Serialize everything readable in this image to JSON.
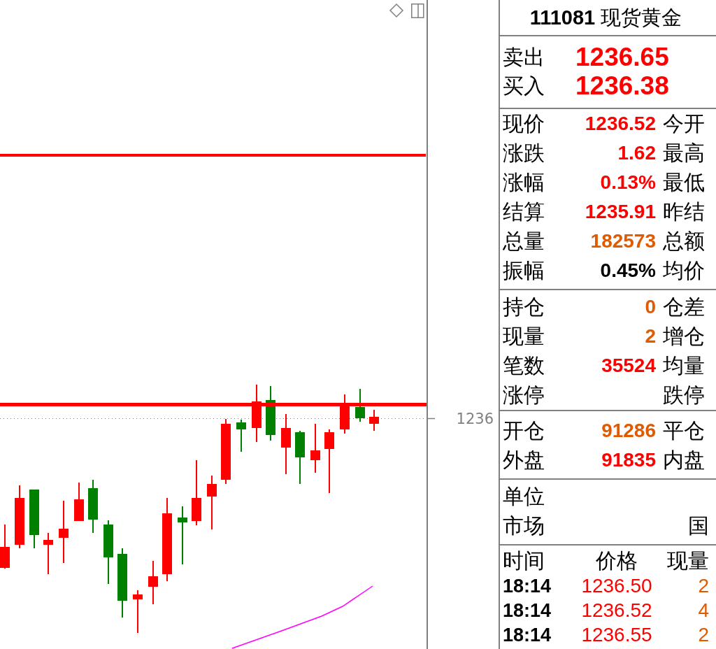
{
  "chart": {
    "price_label": "1236"
  },
  "panel": {
    "title": "**111081** 现货黄金",
    "bid_ask": [
      {
        "label": "卖出",
        "value": "1236.65"
      },
      {
        "label": "买入",
        "value": "1236.38"
      }
    ],
    "quotes": [
      {
        "label": "现价",
        "value": "1236.52",
        "color": "#ff0000",
        "right_label": "今开"
      },
      {
        "label": "涨跌",
        "value": "1.62",
        "color": "#ff0000",
        "right_label": "最高"
      },
      {
        "label": "涨幅",
        "value": "0.13%",
        "color": "#ff0000",
        "right_label": "最低"
      },
      {
        "label": "结算",
        "value": "1235.91",
        "color": "#ff0000",
        "right_label": "昨结"
      },
      {
        "label": "总量",
        "value": "182573",
        "color": "#e05a00",
        "right_label": "总额"
      },
      {
        "label": "振幅",
        "value": "0.45%",
        "color": "#000000",
        "right_label": "均价"
      }
    ],
    "positions": [
      {
        "label": "持仓",
        "value": "0",
        "color": "#e05a00",
        "right_label": "仓差"
      },
      {
        "label": "现量",
        "value": "2",
        "color": "#e05a00",
        "right_label": "增仓"
      },
      {
        "label": "笔数",
        "value": "35524",
        "color": "#ff0000",
        "right_label": "均量"
      },
      {
        "label": "涨停",
        "right_label": "跌停"
      }
    ],
    "trades": [
      {
        "label": "开仓",
        "value": "91286",
        "color": "#e05a00",
        "right_label": "平仓"
      },
      {
        "label": "外盘",
        "value": "91835",
        "color": "#ff0000",
        "right_label": "内盘"
      }
    ],
    "info": [
      {
        "label": "单位"
      },
      {
        "label": "市场",
        "value": "国"
      }
    ],
    "ticks": {
      "columns": [
        "时间",
        "价格",
        "现量"
      ],
      "rows": [
        {
          "time": "18:14",
          "price": "1236.50",
          "volume": "2"
        },
        {
          "time": "18:14",
          "price": "1236.52",
          "volume": "4"
        },
        {
          "time": "18:14",
          "price": "1236.55",
          "volume": "2"
        }
      ]
    }
  }
}
